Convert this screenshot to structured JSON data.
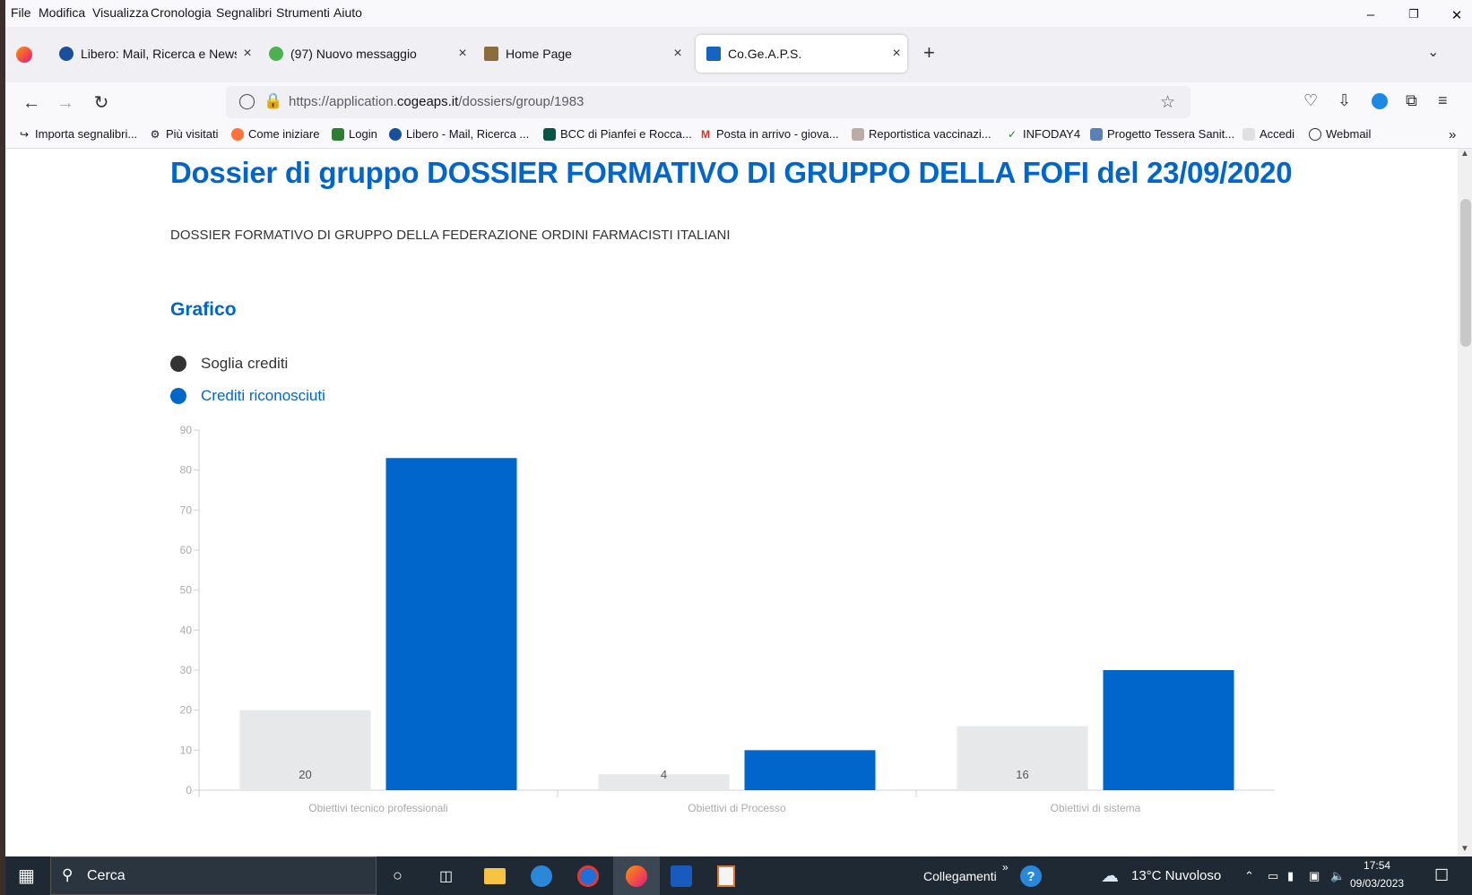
{
  "menu": [
    "File",
    "Modifica",
    "Visualizza",
    "Cronologia",
    "Segnalibri",
    "Strumenti",
    "Aiuto"
  ],
  "tabs": [
    {
      "label": "Libero: Mail, Ricerca e News con",
      "color": "#1a4f9c"
    },
    {
      "label": "(97) Nuovo messaggio",
      "color": "#4caf50"
    },
    {
      "label": "Home Page",
      "color": "#8a6d3b"
    },
    {
      "label": "Co.Ge.A.P.S.",
      "color": "#1565c0"
    }
  ],
  "address": {
    "prefix": "https://application.",
    "domain": "cogeaps.it",
    "path": "/dossiers/group/1983"
  },
  "bookmarks": [
    "Importa segnalibri...",
    "Più visitati",
    "Come iniziare",
    "Login",
    "Libero - Mail, Ricerca ...",
    "BCC di Pianfei e Rocca...",
    "Posta in arrivo - giova...",
    "Reportistica vaccinazi...",
    "INFODAY4",
    "Progetto Tessera Sanit...",
    "Accedi",
    "Webmail"
  ],
  "page": {
    "title": "Dossier di gruppo DOSSIER FORMATIVO DI GRUPPO DELLA FOFI del 23/09/2020",
    "description": "DOSSIER FORMATIVO DI GRUPPO DELLA FEDERAZIONE ORDINI FARMACISTI ITALIANI",
    "section": "Grafico"
  },
  "colors": {
    "accent": "#0066cc",
    "threshold": "#e6e8ea",
    "legend_dark": "#333333"
  },
  "chart_data": {
    "type": "bar",
    "categories": [
      "Obiettivi tecnico professionali",
      "Obiettivi di Processo",
      "Obiettivi di sistema"
    ],
    "series": [
      {
        "name": "Soglia crediti",
        "values": [
          20,
          4,
          16
        ],
        "labels": [
          "20",
          "4",
          "16"
        ]
      },
      {
        "name": "Crediti riconosciuti",
        "values": [
          83,
          10,
          30
        ]
      }
    ],
    "yticks": [
      0,
      10,
      20,
      30,
      40,
      50,
      60,
      70,
      80,
      90
    ],
    "ylim": [
      0,
      90
    ],
    "grid": false,
    "legend": "top-left"
  },
  "taskbar": {
    "search": "Cerca",
    "links": "Collegamenti",
    "weather": "13°C  Nuvoloso",
    "time": "17:54",
    "date": "09/03/2023"
  }
}
